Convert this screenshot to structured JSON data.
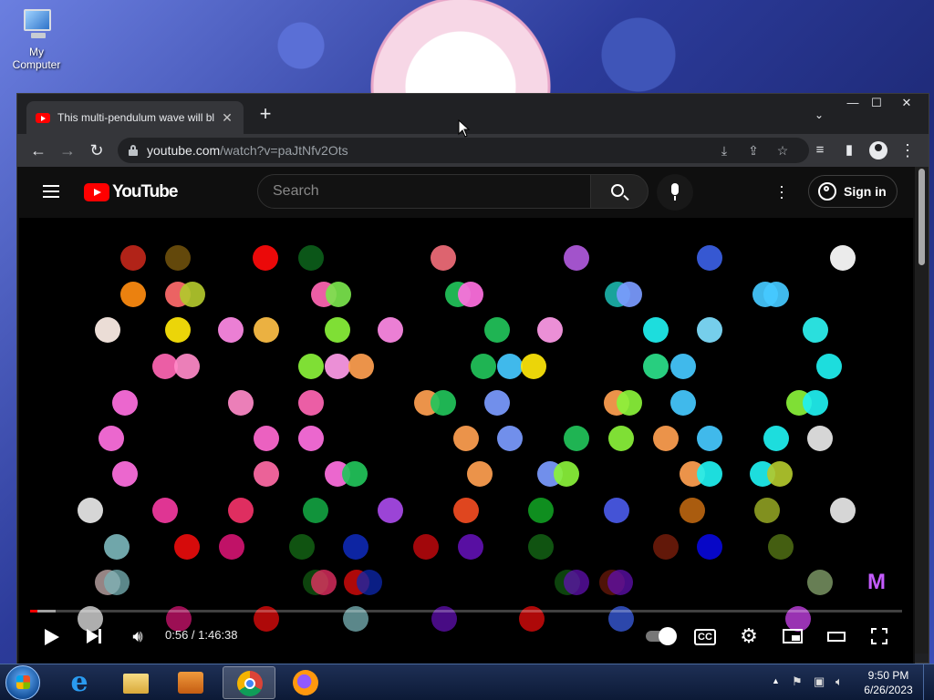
{
  "desktop": {
    "icons": [
      {
        "label": "My Computer",
        "icon": "computer-icon"
      }
    ]
  },
  "browser": {
    "tab": {
      "title": "This multi-pendulum wave will bl",
      "close": "✕"
    },
    "new_tab": "+",
    "tab_search": "⌄",
    "window_controls": {
      "minimize": "—",
      "maximize": "☐",
      "close": "✕"
    },
    "nav": {
      "back": "←",
      "forward": "→",
      "reload": "↻"
    },
    "url": {
      "host": "youtube.com",
      "path": "/watch?v=paJtNfv2Ots"
    },
    "omnibox_icons": [
      "install-icon",
      "share-icon",
      "bookmark-star-icon"
    ],
    "toolbar_icons": [
      "media-controls-icon",
      "side-panel-icon",
      "profile-icon",
      "menu-dots-icon"
    ]
  },
  "youtube": {
    "logo_text": "YouTube",
    "search_placeholder": "Search",
    "sign_in": "Sign in"
  },
  "player": {
    "time_current": "0:56",
    "time_total": "1:46:38",
    "time_display": "0:56 / 1:46:38",
    "progress_fraction": 0.0088,
    "buffered_fraction": 0.029,
    "channel_watermark": "M"
  },
  "video_frame": {
    "description_free": true,
    "dot_colors": [
      "#c0261a",
      "#6b4e0c",
      "#ff0a0a",
      "#0c5d1a",
      "#f06c78",
      "#b05adc",
      "#3b5fe4",
      "#ffffff",
      "#ff8c10",
      "#ff6b6b",
      "#b2c82c",
      "#ff66b3",
      "#7ae44c",
      "#22c35a",
      "#ff70e0",
      "#1bb1a8",
      "#7b9bff",
      "#45c9ff",
      "#fff0e8",
      "#ffe70a",
      "#ff8ae6",
      "#ffc046",
      "#8af23a",
      "#ff9be8",
      "#2be08a",
      "#1ff0f0",
      "#80e0ff",
      "#2ef2f0",
      "#ff8ac8",
      "#ff9f50",
      "#e8e8e8",
      "#ff69d0",
      "#ff6aa5",
      "#f23aa0",
      "#f23268",
      "#12a040",
      "#a84ae8",
      "#f24c22",
      "#109a22",
      "#4a5ae8",
      "#b86410",
      "#8c9c22",
      "#7ab4b8",
      "#e80c0c",
      "#d01470",
      "#115a12",
      "#0e28b0",
      "#b0080c",
      "#6010b0",
      "#6a1a0a",
      "#0808d8",
      "#4a6612",
      "#c8b0b0",
      "#8aa870",
      "#cc44ee"
    ]
  },
  "taskbar": {
    "apps": [
      {
        "name": "internet-explorer",
        "active": false
      },
      {
        "name": "file-explorer",
        "active": false
      },
      {
        "name": "media-player",
        "active": false
      },
      {
        "name": "chrome",
        "active": true
      },
      {
        "name": "firefox",
        "active": false
      }
    ],
    "clock": {
      "time": "9:50 PM",
      "date": "6/26/2023"
    }
  }
}
